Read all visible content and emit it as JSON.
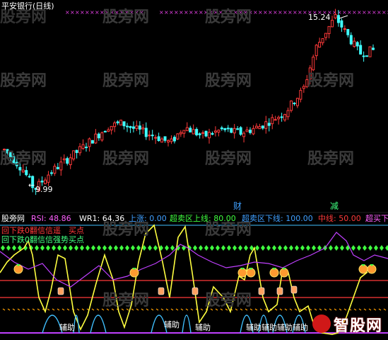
{
  "top_panel": {
    "title": "平安银行(日线)",
    "high_label": "15.24",
    "low_label": "9.99",
    "tag_cai": "财",
    "tag_jian": "减"
  },
  "indicator_header": {
    "name": "股旁网",
    "rsi": "RSI: 48.86",
    "wr": "WR1: 64.36",
    "up": "上涨: 0.00",
    "overbought_upper": "超卖区上线: 80.00",
    "oversold_lower": "超卖区下线: 100.00",
    "mid": "中线: 50.00",
    "overbuy": "超买下"
  },
  "overlay_text": {
    "line1": "回下跌0翻信信遥　买点",
    "line2": "回下跌0翻信信强势买点"
  },
  "bottom_labels": [
    "辅助",
    "辅助",
    "辅助",
    "辅助辅助",
    "辅助辅助",
    "辅助",
    "辅助"
  ],
  "watermark": "股旁网",
  "logo_text": "智股网",
  "colors": {
    "up": "#ff3a3a",
    "down": "#40ffff",
    "yellow": "#ffff40",
    "purple": "#c040ff",
    "green": "#40ff40",
    "white": "#ffffff",
    "cyan": "#40c0ff",
    "red_line": "#ff3a3a",
    "orange": "#ffa000"
  },
  "chart_data": {
    "type": "candlestick",
    "title": "平安银行(日线)",
    "high": 15.24,
    "low": 9.99
  }
}
